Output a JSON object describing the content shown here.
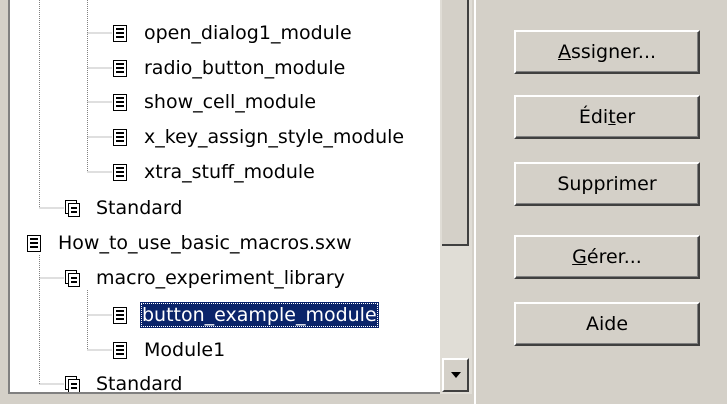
{
  "tree": {
    "items": [
      {
        "label": "open_dialog1_module",
        "icon": "module-icon"
      },
      {
        "label": "radio_button_module",
        "icon": "module-icon"
      },
      {
        "label": "show_cell_module",
        "icon": "module-icon"
      },
      {
        "label": "x_key_assign_style_module",
        "icon": "module-icon"
      },
      {
        "label": "xtra_stuff_module",
        "icon": "module-icon"
      },
      {
        "label": "Standard",
        "icon": "library-icon"
      },
      {
        "label": "How_to_use_basic_macros.sxw",
        "icon": "document-icon"
      },
      {
        "label": "macro_experiment_library",
        "icon": "library-icon"
      },
      {
        "label": "button_example_module",
        "icon": "module-icon",
        "selected": true
      },
      {
        "label": "Module1",
        "icon": "module-icon"
      },
      {
        "label": "Standard",
        "icon": "library-icon"
      }
    ],
    "selection_color": "#0a246a"
  },
  "buttons": {
    "assign": {
      "pre": "",
      "key": "A",
      "post": "ssigner..."
    },
    "edit": {
      "pre": "Édi",
      "key": "t",
      "post": "er"
    },
    "delete": {
      "pre": "",
      "key": "",
      "post": "Supprimer"
    },
    "manage": {
      "pre": "",
      "key": "G",
      "post": "érer..."
    },
    "help": {
      "pre": "",
      "key": "",
      "post": "Aide"
    }
  }
}
